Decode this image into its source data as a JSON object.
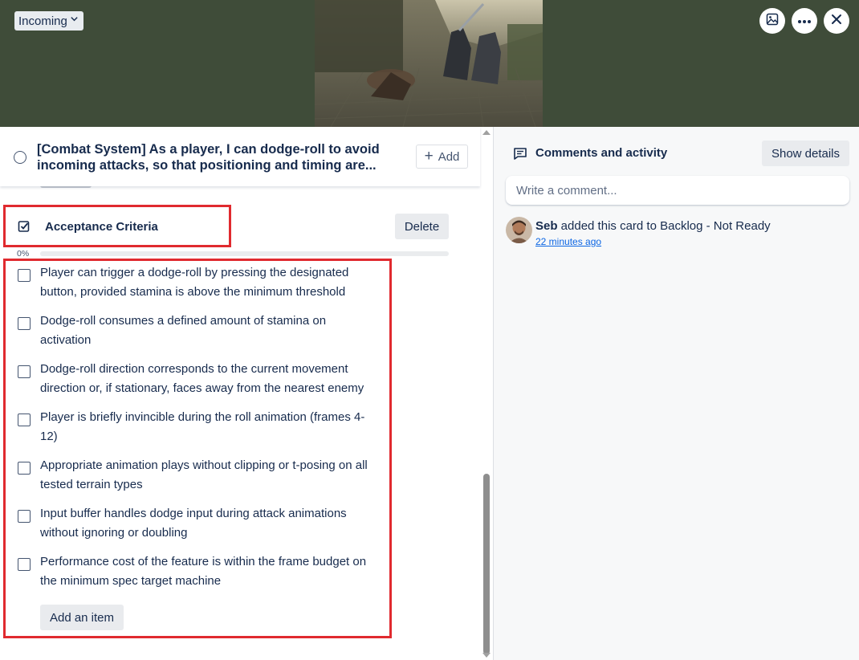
{
  "header": {
    "list_name": "Incoming",
    "icons": {
      "list_dropdown": "chevron-down-icon",
      "cover": "image-icon",
      "more": "more-horizontal-icon",
      "close": "close-icon"
    }
  },
  "card": {
    "title_line1": "[Combat System] As a player, I can dodge-roll to avoid",
    "title_line2": "incoming attacks, so that positioning and timing are...",
    "add_label": "Add"
  },
  "checklist": {
    "title": "Acceptance Criteria",
    "delete_label": "Delete",
    "progress_label": "0%",
    "progress_value": 0,
    "items": [
      {
        "line1": "Player can trigger a dodge-roll by pressing the designated",
        "line2": "button, provided stamina is above the minimum threshold",
        "checked": false
      },
      {
        "line1": "Dodge-roll consumes a defined amount of stamina on",
        "line2": "activation",
        "checked": false
      },
      {
        "line1": "Dodge-roll direction corresponds to the current movement",
        "line2": "direction or, if stationary, faces away from the nearest enemy",
        "checked": false
      },
      {
        "line1": "Player is briefly invincible during the roll animation (frames 4-",
        "line2": "12)",
        "checked": false
      },
      {
        "line1": "Appropriate animation plays without clipping or t-posing on all",
        "line2": "tested terrain types",
        "checked": false
      },
      {
        "line1": "Input buffer handles dodge input during attack animations",
        "line2": "without ignoring or doubling",
        "checked": false
      },
      {
        "line1": "Performance cost of the feature is within the frame budget on",
        "line2": "the minimum spec target machine",
        "checked": false
      }
    ],
    "add_item_label": "Add an item"
  },
  "activity": {
    "title": "Comments and activity",
    "show_details_label": "Show details",
    "comment_placeholder": "Write a comment...",
    "entries": [
      {
        "user": "Seb",
        "action": " added this card to Backlog - Not Ready",
        "time": "22 minutes ago"
      }
    ]
  },
  "colors": {
    "cover_background": "#3f4c39",
    "highlight_border": "#e02a2f",
    "link": "#0c66e4"
  }
}
